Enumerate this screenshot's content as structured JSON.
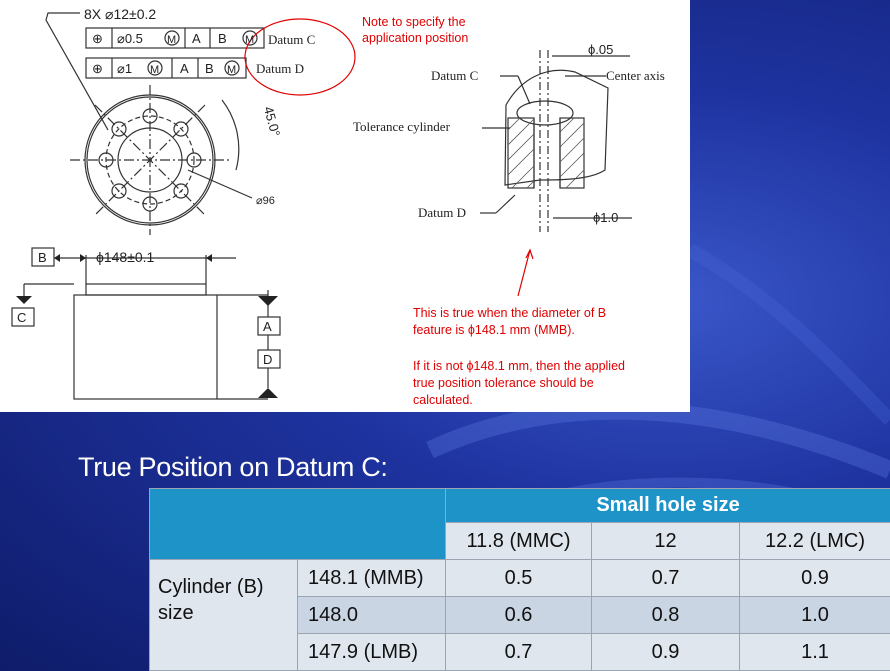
{
  "drawing": {
    "callout_qty": "8X ⌀12±0.2",
    "fcf_row1": [
      "⊕",
      "⌀0.5",
      "M",
      "A",
      "B",
      "M"
    ],
    "fcf_row2": [
      "⊕",
      "⌀1",
      "M",
      "A",
      "B",
      "M"
    ],
    "datum_c_label": "Datum C",
    "datum_d_label": "Datum D",
    "angle_label": "45.0°",
    "bolt_circle_label": "⌀96",
    "datum_b_letter": "B",
    "datum_c_letter": "C",
    "datum_a_letter": "A",
    "datum_d_letter": "D",
    "cylinder_dim": "ϕ148±0.1",
    "note_app": "Note to specify the application position",
    "tol_05": "ϕ.05",
    "center_axis": "Center axis",
    "datum_c_callout": "Datum C",
    "tol_cylinder": "Tolerance cylinder",
    "datum_d_callout": "Datum D",
    "tol_10": "ϕ1.0",
    "note_true_1": "This is true when the diameter of B feature is ϕ148.1 mm (MMB).",
    "note_true_2": "If it is not ϕ148.1 mm, then the applied true position tolerance should be calculated."
  },
  "heading": "True Position on Datum C:",
  "table": {
    "group_header": "Small hole size",
    "col_headers": [
      "11.8 (MMC)",
      "12",
      "12.2 (LMC)"
    ],
    "row_group_label": "Cylinder (B) size",
    "rows": [
      {
        "label": "148.1 (MMB)",
        "values": [
          "0.5",
          "0.7",
          "0.9"
        ]
      },
      {
        "label": "148.0",
        "values": [
          "0.6",
          "0.8",
          "1.0"
        ]
      },
      {
        "label": "147.9 (LMB)",
        "values": [
          "0.7",
          "0.9",
          "1.1"
        ]
      }
    ]
  },
  "colors": {
    "table_header": "#1e93c8",
    "table_row": "#dfe6ee",
    "table_row_alt": "#c9d5e3",
    "slide_bg": "#1e33a0",
    "annotation": "#e00000"
  }
}
